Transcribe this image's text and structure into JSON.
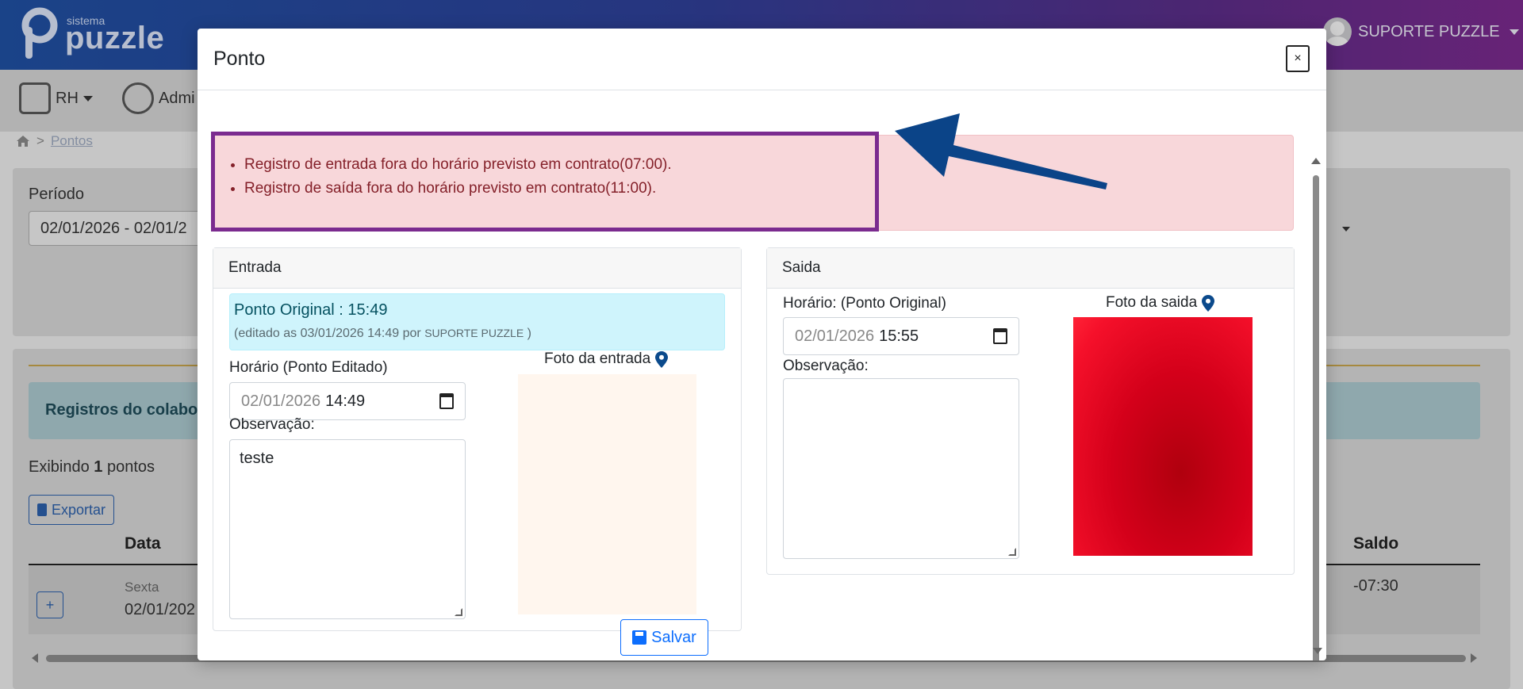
{
  "app": {
    "logo_small": "sistema",
    "logo_text": "puzzle",
    "user_name": "SUPORTE PUZZLE"
  },
  "menu": {
    "items": [
      {
        "label": "RH"
      },
      {
        "label": "Admi"
      }
    ]
  },
  "breadcrumb": {
    "current": "Pontos",
    "separator": ">"
  },
  "filters": {
    "periodo_label": "Período",
    "periodo_value": "02/01/2026 - 02/01/2"
  },
  "records": {
    "info_text": "Registros do colabor",
    "exibindo_prefix": "Exibindo",
    "exibindo_count": "1",
    "exibindo_suffix": "pontos",
    "export_label": "Exportar",
    "columns": {
      "data": "Data",
      "saldo": "Saldo"
    },
    "row": {
      "expand": "+",
      "weekday": "Sexta",
      "date": "02/01/202",
      "saldo": "-07:30"
    }
  },
  "modal": {
    "title": "Ponto",
    "close": "×",
    "alerts": [
      "Registro de entrada fora do horário previsto em contrato(07:00).",
      "Registro de saída fora do horário previsto em contrato(11:00)."
    ],
    "entrada": {
      "header": "Entrada",
      "original_title": "Ponto Original : 15:49",
      "original_edit_prefix": "(editado as 03/01/2026 14:49 por ",
      "original_edit_user": "SUPORTE PUZZLE",
      "original_edit_suffix": " )",
      "horario_label": "Horário (Ponto Editado)",
      "horario_date": "02/01/2026",
      "horario_time": "14:49",
      "obs_label": "Observação:",
      "obs_value": "teste",
      "foto_label": "Foto da entrada"
    },
    "saida": {
      "header": "Saida",
      "horario_label": "Horário: (Ponto Original)",
      "horario_date": "02/01/2026",
      "horario_time": "15:55",
      "obs_label": "Observação:",
      "obs_value": "",
      "foto_label": "Foto da saida"
    },
    "save_label": "Salvar"
  },
  "colors": {
    "alert_bg": "#f8d7da",
    "highlight_border": "#7b2b8f",
    "arrow": "#0b4488",
    "primary": "#0d6efd"
  }
}
